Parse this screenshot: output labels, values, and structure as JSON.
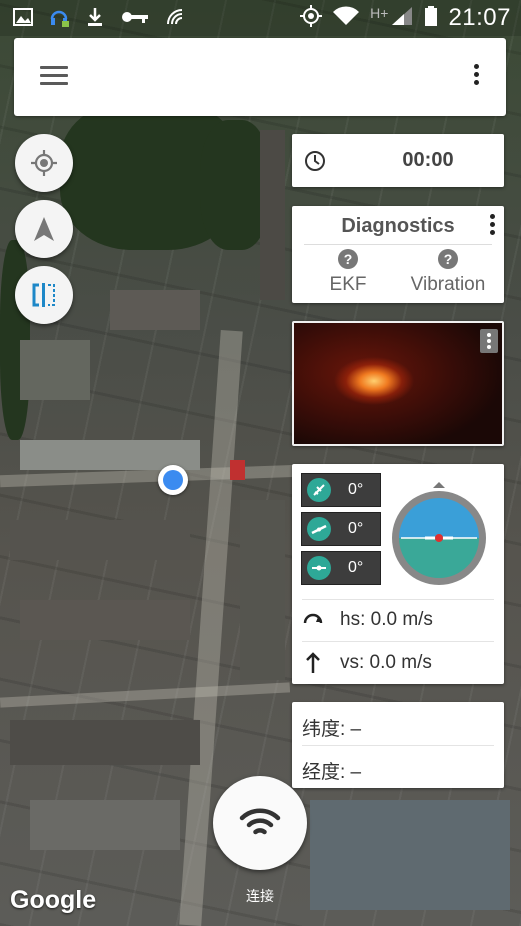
{
  "status_bar": {
    "time": "21:07",
    "network_type": "H+",
    "left_icons": [
      "image-icon",
      "headset-icon",
      "download-icon",
      "key-icon",
      "nfc-icon"
    ],
    "right_icons": [
      "gps-icon",
      "wifi-icon",
      "signal-icon",
      "battery-icon"
    ]
  },
  "app_bar": {
    "menu_icon": "hamburger-icon",
    "overflow_icon": "more-vertical-icon"
  },
  "map_controls": {
    "locate_icon": "my-location-icon",
    "navigate_icon": "navigation-arrow-icon",
    "split_icon": "split-view-icon",
    "accent": "#1e88c8"
  },
  "timer": {
    "icon": "clock-icon",
    "value": "00:00"
  },
  "diagnostics": {
    "title": "Diagnostics",
    "items": [
      {
        "label": "EKF",
        "icon": "help-circle-icon"
      },
      {
        "label": "Vibration",
        "icon": "help-circle-icon"
      }
    ]
  },
  "video": {
    "menu_icon": "more-vertical-icon"
  },
  "attitude": {
    "roll": "0°",
    "pitch": "0°",
    "yaw": "0°",
    "dial_color": "#2ea897",
    "horizon_sky": "#3a9fd8",
    "horizon_ground": "#3aa898",
    "horizontal_speed": "hs: 0.0 m/s",
    "vertical_speed": "vs: 0.0 m/s"
  },
  "coordinates": {
    "latitude": "纬度: –",
    "longitude": "经度: –"
  },
  "connect": {
    "label": "连接",
    "icon": "wifi-icon"
  },
  "map": {
    "attribution": "Google",
    "location_color": "#3b8bf0"
  }
}
